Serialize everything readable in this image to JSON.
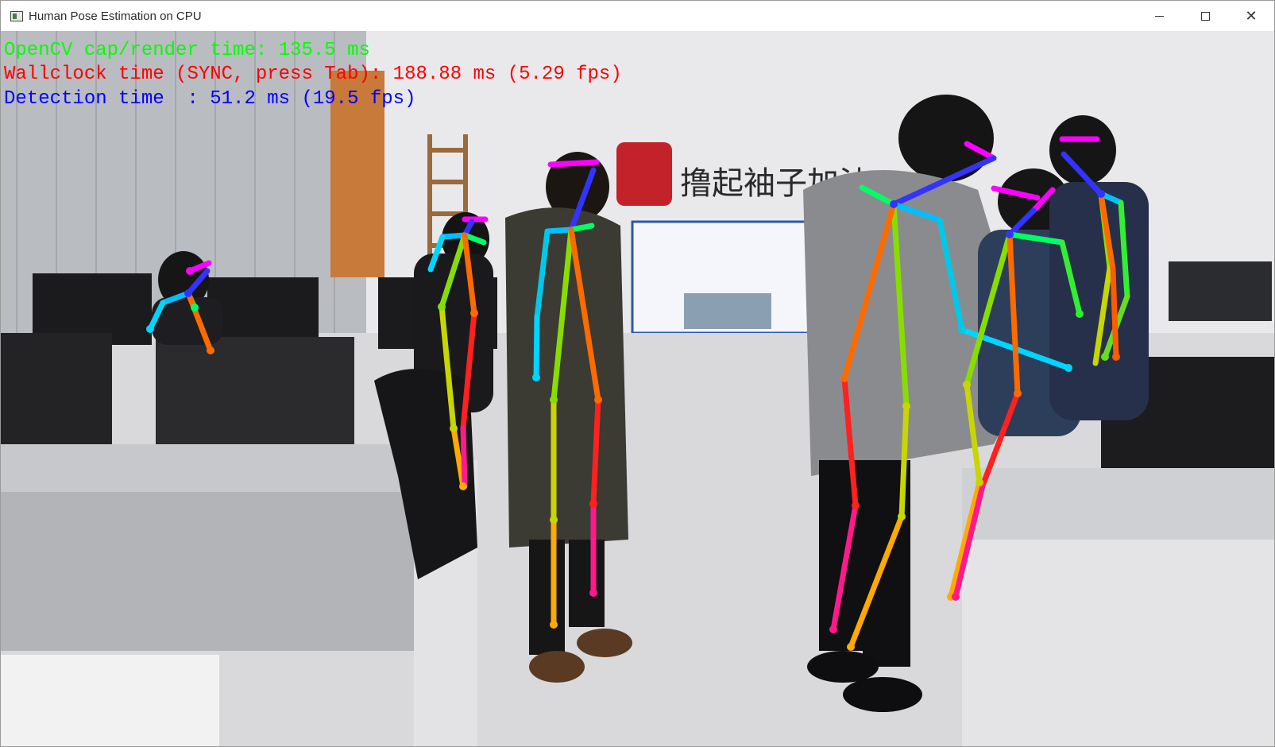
{
  "window": {
    "title": "Human Pose Estimation on CPU",
    "controls": {
      "minimize": "–",
      "maximize": "☐",
      "close": "✕"
    }
  },
  "overlay": {
    "cap_render": "OpenCV cap/render time: 135.5 ms",
    "wallclock": "Wallclock time (SYNC, press Tab): 188.88 ms (5.29 fps)",
    "detection": "Detection time  : 51.2 ms (19.5 fps)"
  },
  "colors": {
    "cap_render": "#00ff00",
    "wallclock": "#ff0000",
    "detection": "#0000ff"
  },
  "scene": {
    "wall_slogan": "撸起袖子加油",
    "people_detected": 6
  }
}
